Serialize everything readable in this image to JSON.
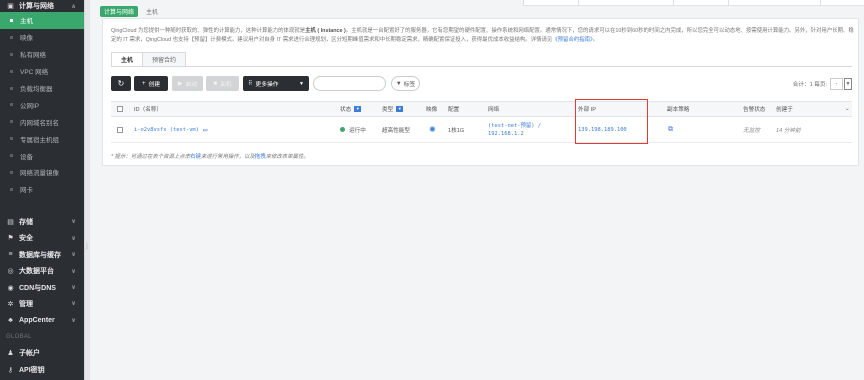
{
  "sidebar": {
    "current_group": "计算与网络",
    "items": [
      {
        "label": "主机",
        "active": true
      },
      {
        "label": "映像"
      },
      {
        "label": "私有网络"
      },
      {
        "label": "VPC 网络"
      },
      {
        "label": "负载均衡器"
      },
      {
        "label": "公网IP"
      },
      {
        "label": "内网域名别名"
      },
      {
        "label": "专属宿主机组"
      },
      {
        "label": "设备"
      },
      {
        "label": "网络流量镜像"
      },
      {
        "label": "网卡"
      }
    ],
    "groups": [
      {
        "label": "存储",
        "icon": "storage-icon"
      },
      {
        "label": "安全",
        "icon": "shield-icon"
      },
      {
        "label": "数据库与缓存",
        "icon": "database-icon"
      },
      {
        "label": "大数据平台",
        "icon": "bigdata-icon"
      },
      {
        "label": "CDN与DNS",
        "icon": "globe-icon"
      },
      {
        "label": "管理",
        "icon": "settings-icon"
      },
      {
        "label": "AppCenter",
        "icon": "appcenter-icon"
      }
    ],
    "global_heading": "GLOBAL",
    "global_items": [
      {
        "label": "子帐户",
        "icon": "users-icon"
      },
      {
        "label": "API密钥",
        "icon": "key-icon"
      }
    ]
  },
  "breadcrumb": {
    "tag": "计算与网络",
    "current": "主机"
  },
  "description": {
    "part1": "QingCloud 为您提供一种随时获取的、弹性的计算能力，这种计算能力的体现就是",
    "bold": "主机 ( Instance )",
    "part2": "。主机就是一台配置好了的服务器，它有您期望的硬件配置、操作系统和网络配置。通常情况下，您的请求可以在10秒到60秒的时间之内完成，所以您完全可以动态地、按需使用计算能力。另外，针对用户长期、稳定的 IT 需求，QingCloud 也支持【预留】计费模式。建议用户对自身 IT 需求进行合理规划，区分短期峰值需求和中长期稳定需求，精确配置保证投入，获得最优成本收益结构。详情请见",
    "link": "《预留合约指南》",
    "end": "。"
  },
  "tabs": [
    "主机",
    "预留合约"
  ],
  "toolbar": {
    "refresh_icon": "refresh-icon",
    "create": "创建",
    "start": "启动",
    "stop": "关机",
    "more": "更多操作",
    "search_placeholder": "",
    "tag": "标签",
    "pager": "合计：1 每页:",
    "page_size": "-"
  },
  "table": {
    "headers": {
      "id": "ID（名称）",
      "state": "状态",
      "type": "类型",
      "image": "映像",
      "config": "配置",
      "network": "网络",
      "eip": "外部 IP",
      "replica": "副本策略",
      "alarm": "告警状态",
      "created": "创建于"
    },
    "rows": [
      {
        "id": "i-o2v8vsfx",
        "name": "(test-vm)",
        "state": "运行中",
        "type": "超高性能型",
        "config": "1核1G",
        "network_line1": "(test-net-预留) /",
        "network_line2": "192.168.1.2",
        "eip": "139.198.189.100",
        "alarm": "无监控",
        "created": "14 分钟前"
      }
    ]
  },
  "note": {
    "prefix": "* 提示：可通过在表个资源上点击",
    "link1": "右键",
    "mid": "来进行常用操作，以及",
    "link2": "拖拽",
    "suffix": "来修改表单属性。"
  },
  "colors": {
    "accent": "#3aa76d",
    "sidebar_bg": "#2b2f33",
    "link": "#3b7dd8",
    "highlight": "#e53935"
  }
}
